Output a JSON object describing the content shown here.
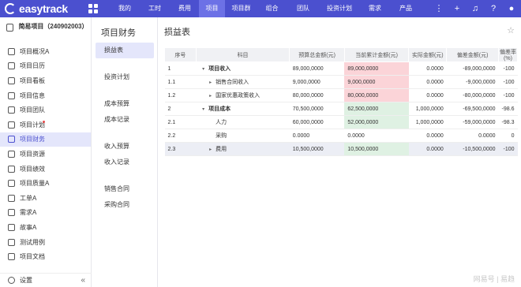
{
  "app": {
    "name": "easytrack"
  },
  "nav": [
    {
      "label": "我的",
      "w": 36,
      "active": false
    },
    {
      "label": "工时",
      "w": 40,
      "active": false
    },
    {
      "label": "费用",
      "w": 36,
      "active": false
    },
    {
      "label": "项目",
      "w": 33,
      "active": true
    },
    {
      "label": "项目群",
      "w": 41,
      "active": false
    },
    {
      "label": "组合",
      "w": 37,
      "active": false
    },
    {
      "label": "团队",
      "w": 42,
      "active": false
    },
    {
      "label": "投资计划",
      "w": 50,
      "active": false
    },
    {
      "label": "需求",
      "w": 40,
      "active": false
    },
    {
      "label": "产品",
      "w": 38,
      "active": false
    }
  ],
  "top_icons": [
    "more-icon",
    "plus-icon",
    "bell-icon",
    "help-icon",
    "user-avatar-icon"
  ],
  "sidebar": {
    "project_name": "简易项目（240902003）",
    "items": [
      {
        "label": "项目概况A"
      },
      {
        "label": "项目日历"
      },
      {
        "label": "项目看板"
      },
      {
        "label": "项目信息"
      },
      {
        "label": "项目团队"
      },
      {
        "label": "项目计划"
      },
      {
        "label": "项目财务"
      },
      {
        "label": "项目资源"
      },
      {
        "label": "项目绩效"
      },
      {
        "label": "项目质量A"
      },
      {
        "label": "工单A"
      },
      {
        "label": "需求A"
      },
      {
        "label": "故事A"
      },
      {
        "label": "测试用例"
      },
      {
        "label": "项目文档"
      }
    ],
    "settings": "设置",
    "collapse": "«"
  },
  "subnav": {
    "title": "项目财务",
    "items": [
      {
        "label": "损益表",
        "gap": 0,
        "active": true
      },
      {
        "label": "投资计划",
        "gap": 14,
        "active": false
      },
      {
        "label": "成本预算",
        "gap": 14,
        "active": false
      },
      {
        "label": "成本记录",
        "gap": 0,
        "active": false
      },
      {
        "label": "收入预算",
        "gap": 14,
        "active": false
      },
      {
        "label": "收入记录",
        "gap": 0,
        "active": false
      },
      {
        "label": "销售合同",
        "gap": 14,
        "active": false
      },
      {
        "label": "采购合同",
        "gap": 0,
        "active": false
      }
    ]
  },
  "main": {
    "title": "损益表",
    "headers": [
      "序号",
      "科目",
      "预算总金额(元)",
      "当前累计金额(元)",
      "实际金额(元)",
      "偏差金额(元)",
      "偏差率(%)"
    ],
    "rows": [
      {
        "no": "1",
        "subject": "项目收入",
        "bold": true,
        "indent": 0,
        "caret": "▾",
        "budget": "89,000,0000",
        "current": "89,000,0000",
        "color": "red",
        "actual": "0.0000",
        "dev": "-89,000,0000",
        "rate": "-100"
      },
      {
        "no": "1.1",
        "subject": "销售合同收入",
        "bold": false,
        "indent": 1,
        "caret": "▸",
        "budget": "9,000,0000",
        "current": "9,000,0000",
        "color": "red",
        "actual": "0.0000",
        "dev": "-9,000,0000",
        "rate": "-100"
      },
      {
        "no": "1.2",
        "subject": "国家优惠政策收入",
        "bold": false,
        "indent": 1,
        "caret": "▸",
        "budget": "80,000,0000",
        "current": "80,000,0000",
        "color": "red",
        "actual": "0.0000",
        "dev": "-80,000,0000",
        "rate": "-100"
      },
      {
        "no": "2",
        "subject": "项目成本",
        "bold": true,
        "indent": 0,
        "caret": "▾",
        "budget": "70,500,0000",
        "current": "62,500,0000",
        "color": "green",
        "actual": "1,000,0000",
        "dev": "-69,500,0000",
        "rate": "-98.6"
      },
      {
        "no": "2.1",
        "subject": "人力",
        "bold": false,
        "indent": 1,
        "caret": "",
        "budget": "60,000,0000",
        "current": "52,000,0000",
        "color": "green",
        "actual": "1,000,0000",
        "dev": "-59,000,0000",
        "rate": "-98.3"
      },
      {
        "no": "2.2",
        "subject": "采购",
        "bold": false,
        "indent": 1,
        "caret": "",
        "budget": "0.0000",
        "current": "0.0000",
        "color": "",
        "actual": "0.0000",
        "dev": "0.0000",
        "rate": "0"
      },
      {
        "no": "2.3",
        "subject": "费用",
        "bold": false,
        "indent": 1,
        "caret": "▸",
        "budget": "10,500,0000",
        "current": "10,500,0000",
        "color": "green",
        "actual": "0.0000",
        "dev": "-10,500,0000",
        "rate": "-100",
        "highlight": true
      }
    ]
  },
  "watermark": "网易号 | 易趋"
}
